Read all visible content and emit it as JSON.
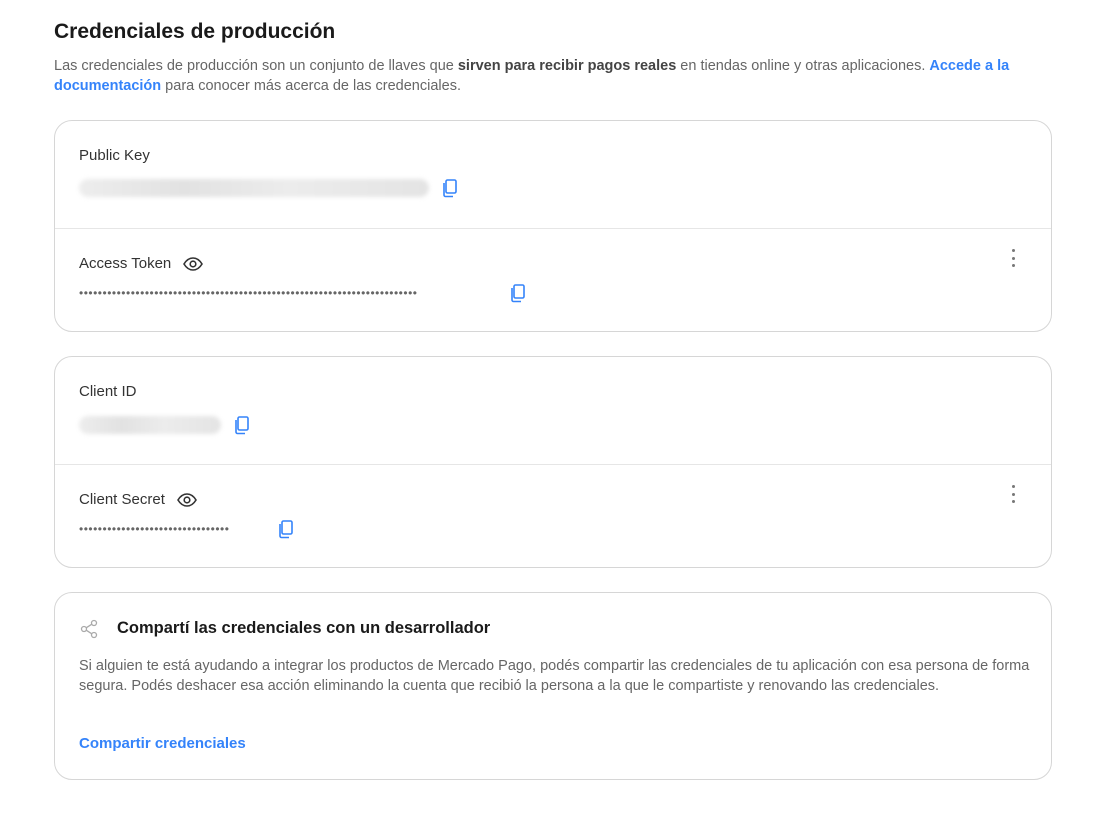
{
  "page": {
    "title": "Credenciales de producción",
    "desc_part1": "Las credenciales de producción son un conjunto de llaves que ",
    "desc_bold": "sirven para recibir pagos reales",
    "desc_part2": " en tiendas online y otras aplicaciones. ",
    "desc_link": "Accede a la documentación",
    "desc_part3": " para conocer más acerca de las credenciales."
  },
  "credentials_group1": {
    "public_key": {
      "label": "Public Key"
    },
    "access_token": {
      "label": "Access Token",
      "masked_value": "••••••••••••••••••••••••••••••••••••••••••••••••••••••••••••••••••••••••"
    }
  },
  "credentials_group2": {
    "client_id": {
      "label": "Client ID"
    },
    "client_secret": {
      "label": "Client Secret",
      "masked_value": "••••••••••••••••••••••••••••••••"
    }
  },
  "share": {
    "title": "Compartí las credenciales con un desarrollador",
    "text": "Si alguien te está ayudando a integrar los productos de Mercado Pago, podés compartir las credenciales de tu aplicación con esa persona de forma segura. Podés deshacer esa acción eliminando la cuenta que recibió la persona a la que le compartiste y renovando las credenciales.",
    "link": "Compartir credenciales"
  },
  "colors": {
    "link": "#3483fa",
    "border": "#d6d6d6"
  }
}
